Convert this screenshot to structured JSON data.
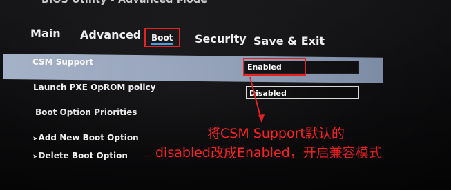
{
  "window": {
    "title": "BIOS Utility - Advanced Mode"
  },
  "tabs": [
    {
      "label": "Main"
    },
    {
      "label": "Advanced"
    },
    {
      "label": "Boot"
    },
    {
      "label": "Security"
    },
    {
      "label": "Save & Exit"
    }
  ],
  "settings": {
    "csm_support": {
      "label": "CSM Support",
      "value": "Enabled"
    },
    "pxe_policy": {
      "label": "Launch PXE OpROM policy",
      "value": "Disabled"
    },
    "boot_priorities": {
      "label": "Boot Option Priorities"
    },
    "add_boot_option": {
      "label": "Add New Boot Option"
    },
    "delete_boot_option": {
      "label": "Delete Boot Option"
    }
  },
  "annotation": {
    "line1": "将CSM Support默认的",
    "line2": "disabled改成Enabled，开启兼容模式"
  },
  "colors": {
    "highlight_red": "#e21d1d",
    "selected_row": "#9aa8bf",
    "annotation_text": "#ff1f1f"
  }
}
